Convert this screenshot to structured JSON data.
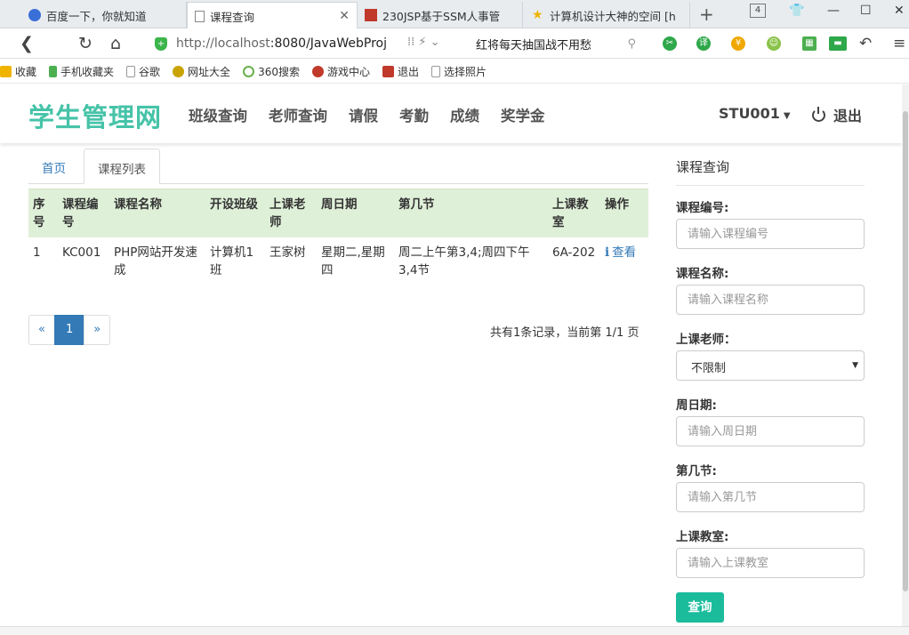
{
  "browser": {
    "tabs": [
      {
        "label": "百度一下，你就知道"
      },
      {
        "label": "课程查询"
      },
      {
        "label": "230JSP基于SSM人事管"
      },
      {
        "label": "计算机设计大神的空间 [h"
      }
    ],
    "tab_count": "4",
    "url_host": "http://localhost",
    "url_rest": ":8080/JavaWebProj",
    "search_text": "红将每天抽国战不用愁",
    "bookmarks": [
      "收藏",
      "手机收藏夹",
      "谷歌",
      "网址大全",
      "360搜索",
      "游戏中心",
      "退出",
      "选择照片"
    ]
  },
  "nav": {
    "brand": "学生管理网",
    "links": [
      "班级查询",
      "老师查询",
      "请假",
      "考勤",
      "成绩",
      "奖学金"
    ],
    "user": "STU001",
    "logout": "退出"
  },
  "tabs": [
    "首页",
    "课程列表"
  ],
  "table": {
    "headers": [
      "序号",
      "课程编号",
      "课程名称",
      "开设班级",
      "上课老师",
      "周日期",
      "第几节",
      "上课教室",
      "操作"
    ],
    "rows": [
      [
        "1",
        "KC001",
        "PHP网站开发速成",
        "计算机1班",
        "王家树",
        "星期二,星期四",
        "周二上午第3,4;周四下午3,4节",
        "6A-202",
        "查看"
      ]
    ]
  },
  "pager": {
    "prev": "«",
    "current": "1",
    "next": "»",
    "info": "共有1条记录，当前第 1/1 页"
  },
  "side": {
    "title": "课程查询",
    "fields": {
      "code_label": "课程编号:",
      "code_ph": "请输入课程编号",
      "name_label": "课程名称:",
      "name_ph": "请输入课程名称",
      "teacher_label": "上课老师：",
      "teacher_value": "不限制",
      "day_label": "周日期:",
      "day_ph": "请输入周日期",
      "section_label": "第几节:",
      "section_ph": "请输入第几节",
      "room_label": "上课教室:",
      "room_ph": "请输入上课教室"
    },
    "query_button": "查询"
  },
  "colors": {
    "brand": "#46c3a8",
    "link": "#337ab7",
    "table_head": "#dff0d8",
    "query_btn": "#1abc9c"
  }
}
